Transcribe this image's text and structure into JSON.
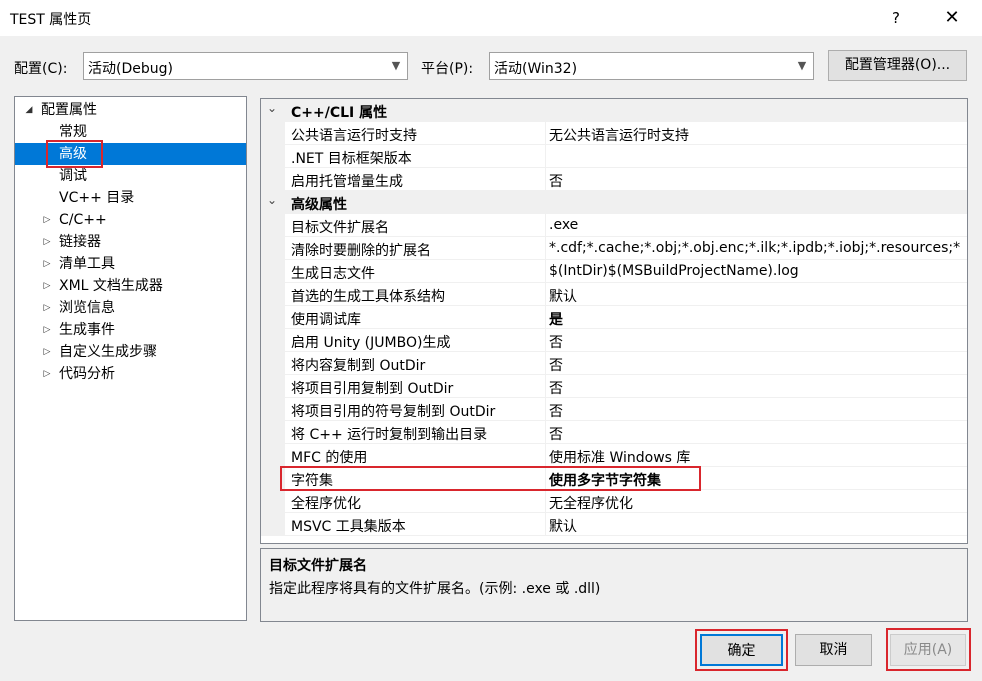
{
  "window": {
    "title": "TEST 属性页",
    "help": "?",
    "close": "✕"
  },
  "config_bar": {
    "config_label": "配置(C):",
    "config_value": "活动(Debug)",
    "platform_label": "平台(P):",
    "platform_value": "活动(Win32)",
    "manager_button": "配置管理器(O)..."
  },
  "tree": {
    "root": "配置属性",
    "items": [
      {
        "label": "常规",
        "expandable": false
      },
      {
        "label": "高级",
        "expandable": false,
        "selected": true
      },
      {
        "label": "调试",
        "expandable": false
      },
      {
        "label": "VC++ 目录",
        "expandable": false
      },
      {
        "label": "C/C++",
        "expandable": true
      },
      {
        "label": "链接器",
        "expandable": true
      },
      {
        "label": "清单工具",
        "expandable": true
      },
      {
        "label": "XML 文档生成器",
        "expandable": true
      },
      {
        "label": "浏览信息",
        "expandable": true
      },
      {
        "label": "生成事件",
        "expandable": true
      },
      {
        "label": "自定义生成步骤",
        "expandable": true
      },
      {
        "label": "代码分析",
        "expandable": true
      }
    ]
  },
  "grid": {
    "categories": [
      {
        "title": "C++/CLI 属性",
        "rows": [
          {
            "name": "公共语言运行时支持",
            "value": "无公共语言运行时支持"
          },
          {
            "name": ".NET 目标框架版本",
            "value": ""
          },
          {
            "name": "启用托管增量生成",
            "value": "否"
          }
        ]
      },
      {
        "title": "高级属性",
        "rows": [
          {
            "name": "目标文件扩展名",
            "value": ".exe"
          },
          {
            "name": "清除时要删除的扩展名",
            "value": "*.cdf;*.cache;*.obj;*.obj.enc;*.ilk;*.ipdb;*.iobj;*.resources;*"
          },
          {
            "name": "生成日志文件",
            "value": "$(IntDir)$(MSBuildProjectName).log"
          },
          {
            "name": "首选的生成工具体系结构",
            "value": "默认"
          },
          {
            "name": "使用调试库",
            "value": "是",
            "bold": true
          },
          {
            "name": "启用 Unity (JUMBO)生成",
            "value": "否"
          },
          {
            "name": "将内容复制到 OutDir",
            "value": "否"
          },
          {
            "name": "将项目引用复制到 OutDir",
            "value": "否"
          },
          {
            "name": "将项目引用的符号复制到 OutDir",
            "value": "否"
          },
          {
            "name": "将 C++ 运行时复制到输出目录",
            "value": "否"
          },
          {
            "name": "MFC 的使用",
            "value": "使用标准 Windows 库"
          },
          {
            "name": "字符集",
            "value": "使用多字节字符集",
            "bold": true
          },
          {
            "name": "全程序优化",
            "value": "无全程序优化"
          },
          {
            "name": "MSVC 工具集版本",
            "value": "默认"
          }
        ]
      }
    ]
  },
  "description": {
    "title": "目标文件扩展名",
    "text": "指定此程序将具有的文件扩展名。(示例: .exe 或 .dll)"
  },
  "buttons": {
    "ok": "确定",
    "cancel": "取消",
    "apply": "应用(A)"
  },
  "colors": {
    "selection": "#0078d7",
    "highlight_box": "#d9262d"
  }
}
